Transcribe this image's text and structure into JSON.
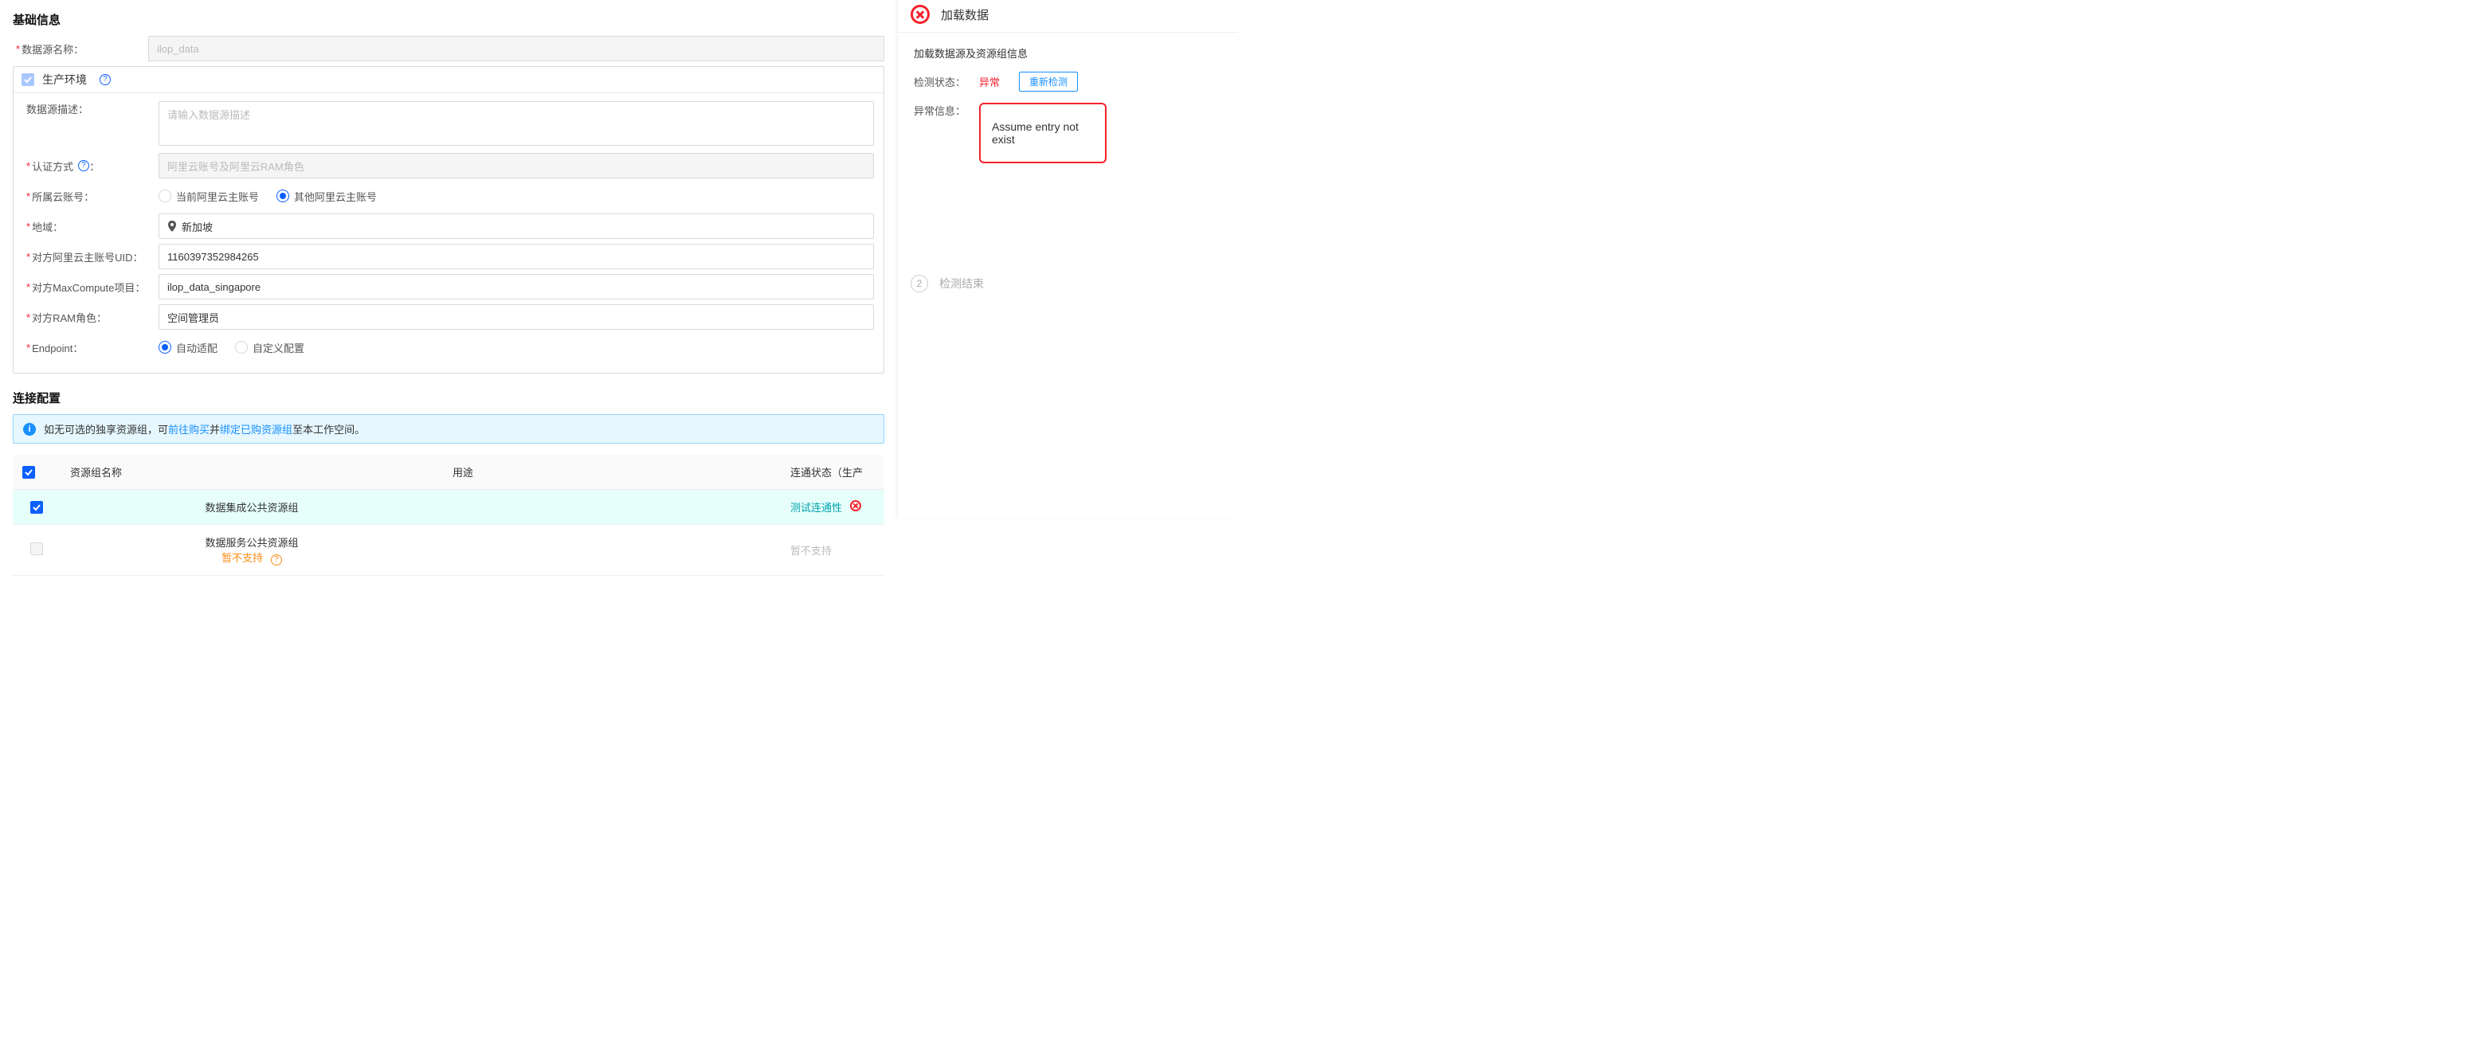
{
  "basic": {
    "title": "基础信息",
    "ds_name_label": "数据源名称：",
    "ds_name_value": "ilop_data",
    "env": {
      "header": "生产环境",
      "desc_label": "数据源描述：",
      "desc_placeholder": "请输入数据源描述",
      "auth_label": "认证方式",
      "auth_value": "阿里云账号及阿里云RAM角色",
      "cloud_acct_label": "所属云账号：",
      "cloud_acct_opt1": "当前阿里云主账号",
      "cloud_acct_opt2": "其他阿里云主账号",
      "region_label": "地域：",
      "region_value": "新加坡",
      "peer_uid_label": "对方阿里云主账号UID：",
      "peer_uid_value": "1160397352984265",
      "mc_proj_label": "对方MaxCompute项目：",
      "mc_proj_value": "ilop_data_singapore",
      "ram_role_label": "对方RAM角色：",
      "ram_role_value": "空间管理员",
      "endpoint_label": "Endpoint：",
      "endpoint_opt1": "自动适配",
      "endpoint_opt2": "自定义配置"
    }
  },
  "conn": {
    "title": "连接配置",
    "alert_pre": "如无可选的独享资源组，可",
    "alert_link1": "前往购买",
    "alert_mid": "并",
    "alert_link2": "绑定已购资源组",
    "alert_post": "至本工作空间。",
    "table": {
      "col_name": "资源组名称",
      "col_use": "用途",
      "col_status": "连通状态（生产",
      "rows": [
        {
          "name": "数据集成公共资源组",
          "status_link": "测试连通性",
          "selected": true,
          "supported": true
        },
        {
          "name": "数据服务公共资源组",
          "unsupported": "暂不支持",
          "status_text": "暂不支持",
          "selected": false,
          "supported": false
        }
      ]
    }
  },
  "rp": {
    "title": "加载数据",
    "subtitle": "加载数据源及资源组信息",
    "status_label": "检测状态：",
    "status_value": "异常",
    "recheck": "重新检测",
    "err_label": "异常信息：",
    "err_value": "Assume entry not exist",
    "step2_num": "2",
    "step2_label": "检测结束"
  }
}
